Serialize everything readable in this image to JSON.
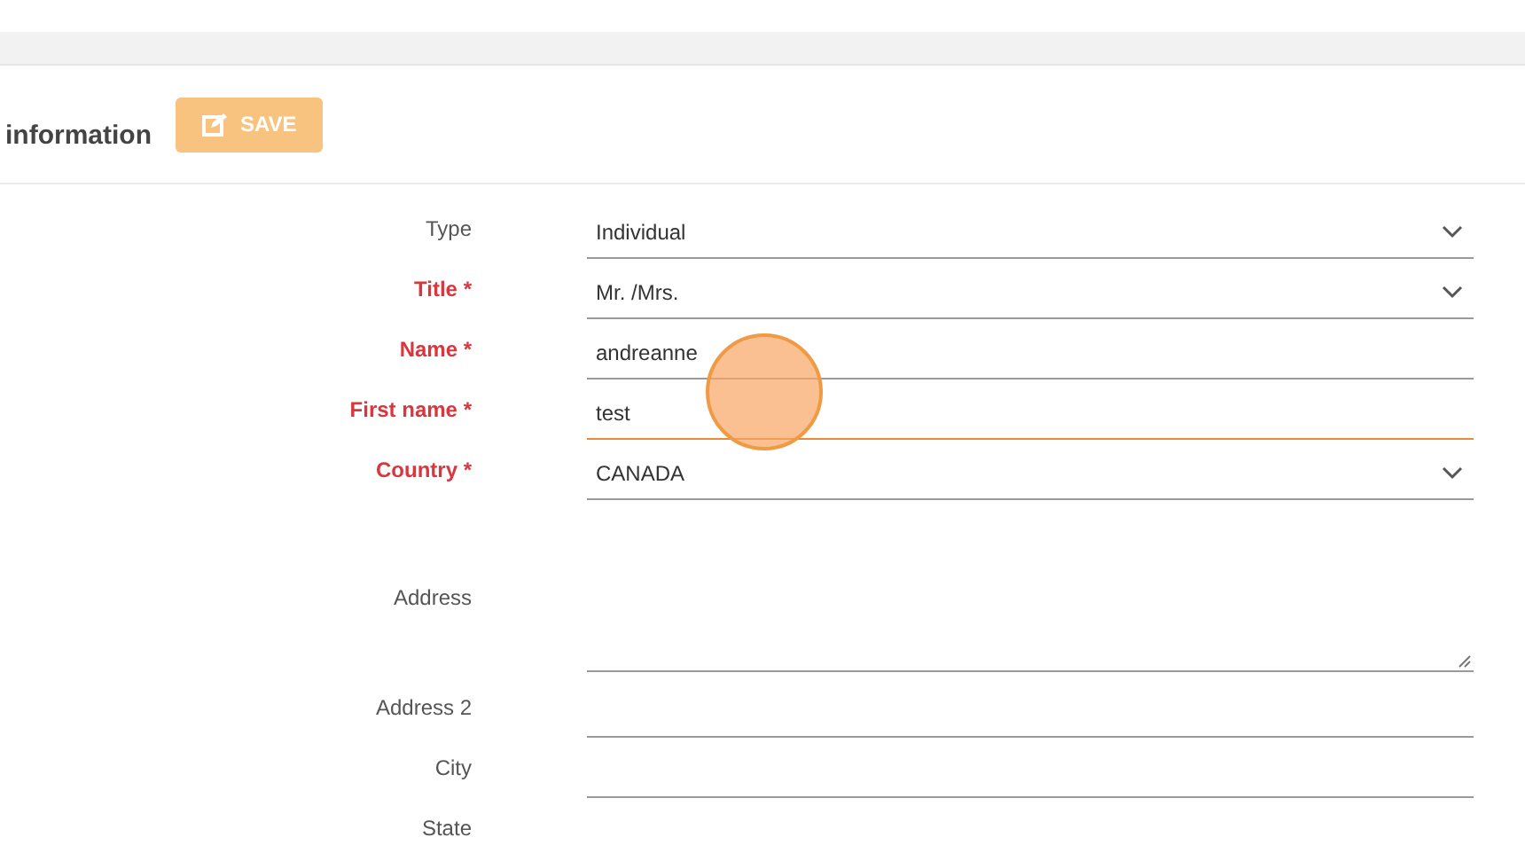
{
  "header": {
    "title": "information",
    "save_button": "SAVE"
  },
  "fields": [
    {
      "label": "Type",
      "kind": "select",
      "required": false,
      "value": "Individual"
    },
    {
      "label": "Title *",
      "kind": "select",
      "required": true,
      "value": "Mr. /Mrs."
    },
    {
      "label": "Name *",
      "kind": "text",
      "required": true,
      "value": "andreanne"
    },
    {
      "label": "First name *",
      "kind": "text",
      "required": true,
      "value": "test",
      "focused": true
    },
    {
      "label": "Country *",
      "kind": "select",
      "required": true,
      "value": "CANADA"
    },
    {
      "label": "Address",
      "kind": "textarea",
      "required": false
    },
    {
      "label": "Address 2",
      "kind": "text",
      "required": false
    },
    {
      "label": "City",
      "kind": "text",
      "required": false
    },
    {
      "label": "State",
      "kind": "cut",
      "required": false
    }
  ]
}
